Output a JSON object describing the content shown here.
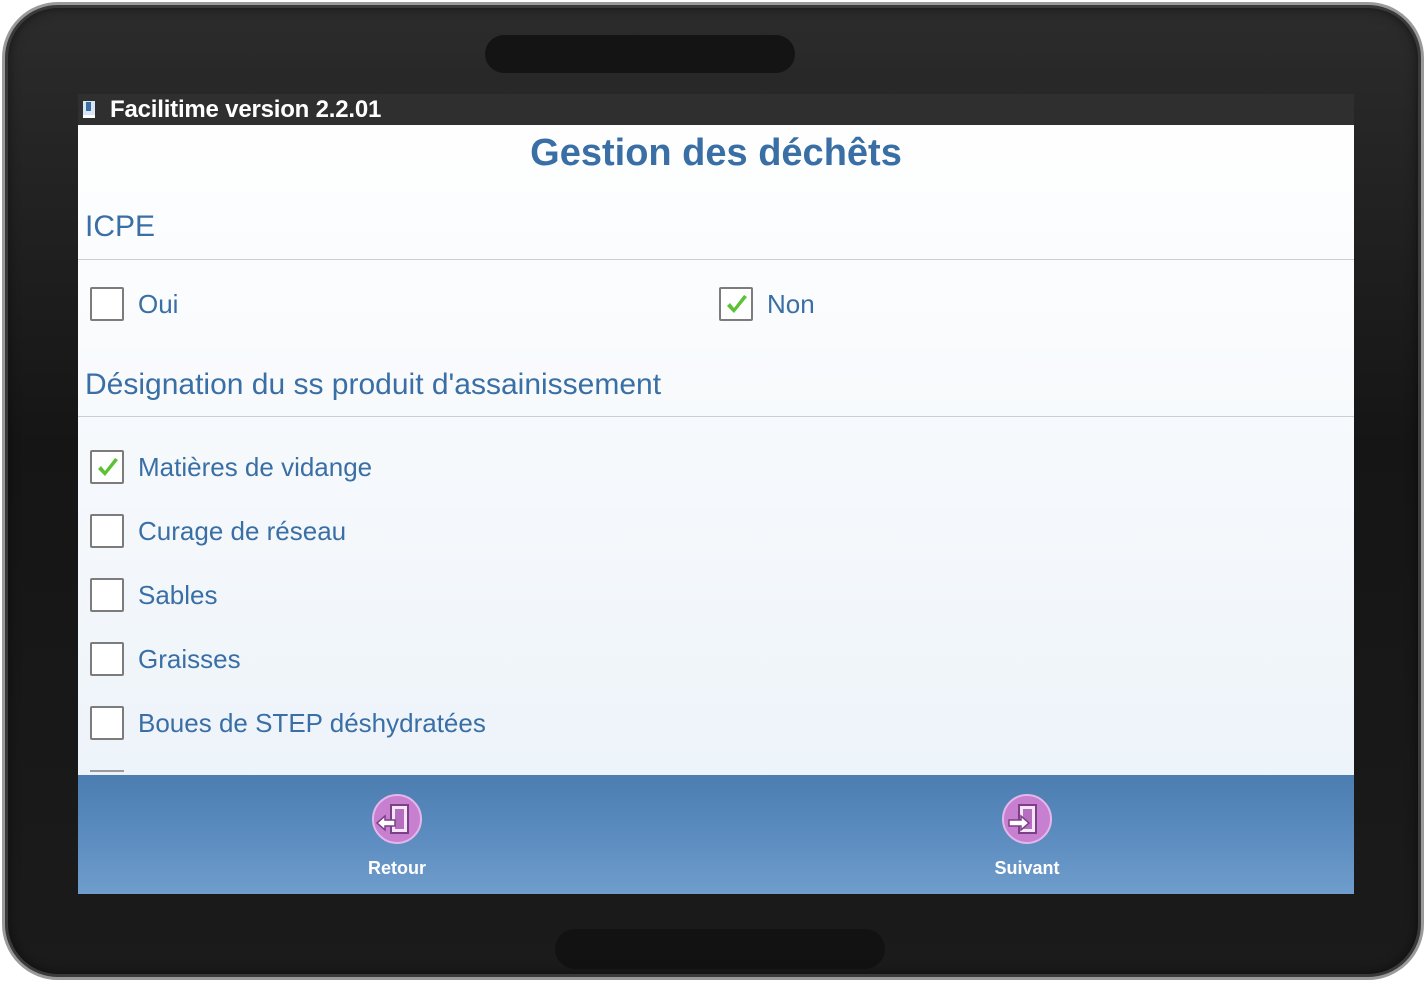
{
  "statusbar": {
    "title": "Facilitime version 2.2.01",
    "app_icon": "app-flag-icon"
  },
  "page": {
    "title": "Gestion des déchêts"
  },
  "icpe": {
    "heading": "ICPE",
    "options": [
      {
        "label": "Oui",
        "checked": false
      },
      {
        "label": "Non",
        "checked": true
      }
    ]
  },
  "designation": {
    "heading": "Désignation du ss produit d'assainissement",
    "items": [
      {
        "label": "Matières de vidange",
        "checked": true
      },
      {
        "label": "Curage de réseau",
        "checked": false
      },
      {
        "label": "Sables",
        "checked": false
      },
      {
        "label": "Graisses",
        "checked": false
      },
      {
        "label": "Boues de STEP déshydratées",
        "checked": false
      }
    ]
  },
  "nav": {
    "back": {
      "label": "Retour",
      "icon": "back-door-icon"
    },
    "next": {
      "label": "Suivant",
      "icon": "next-door-icon"
    }
  },
  "colors": {
    "accent": "#3a6fa6",
    "statusbar": "#2f2f2f",
    "bottombar": "#5f8fc2",
    "check": "#5bc236",
    "nav_icon": "#c77fcf"
  }
}
